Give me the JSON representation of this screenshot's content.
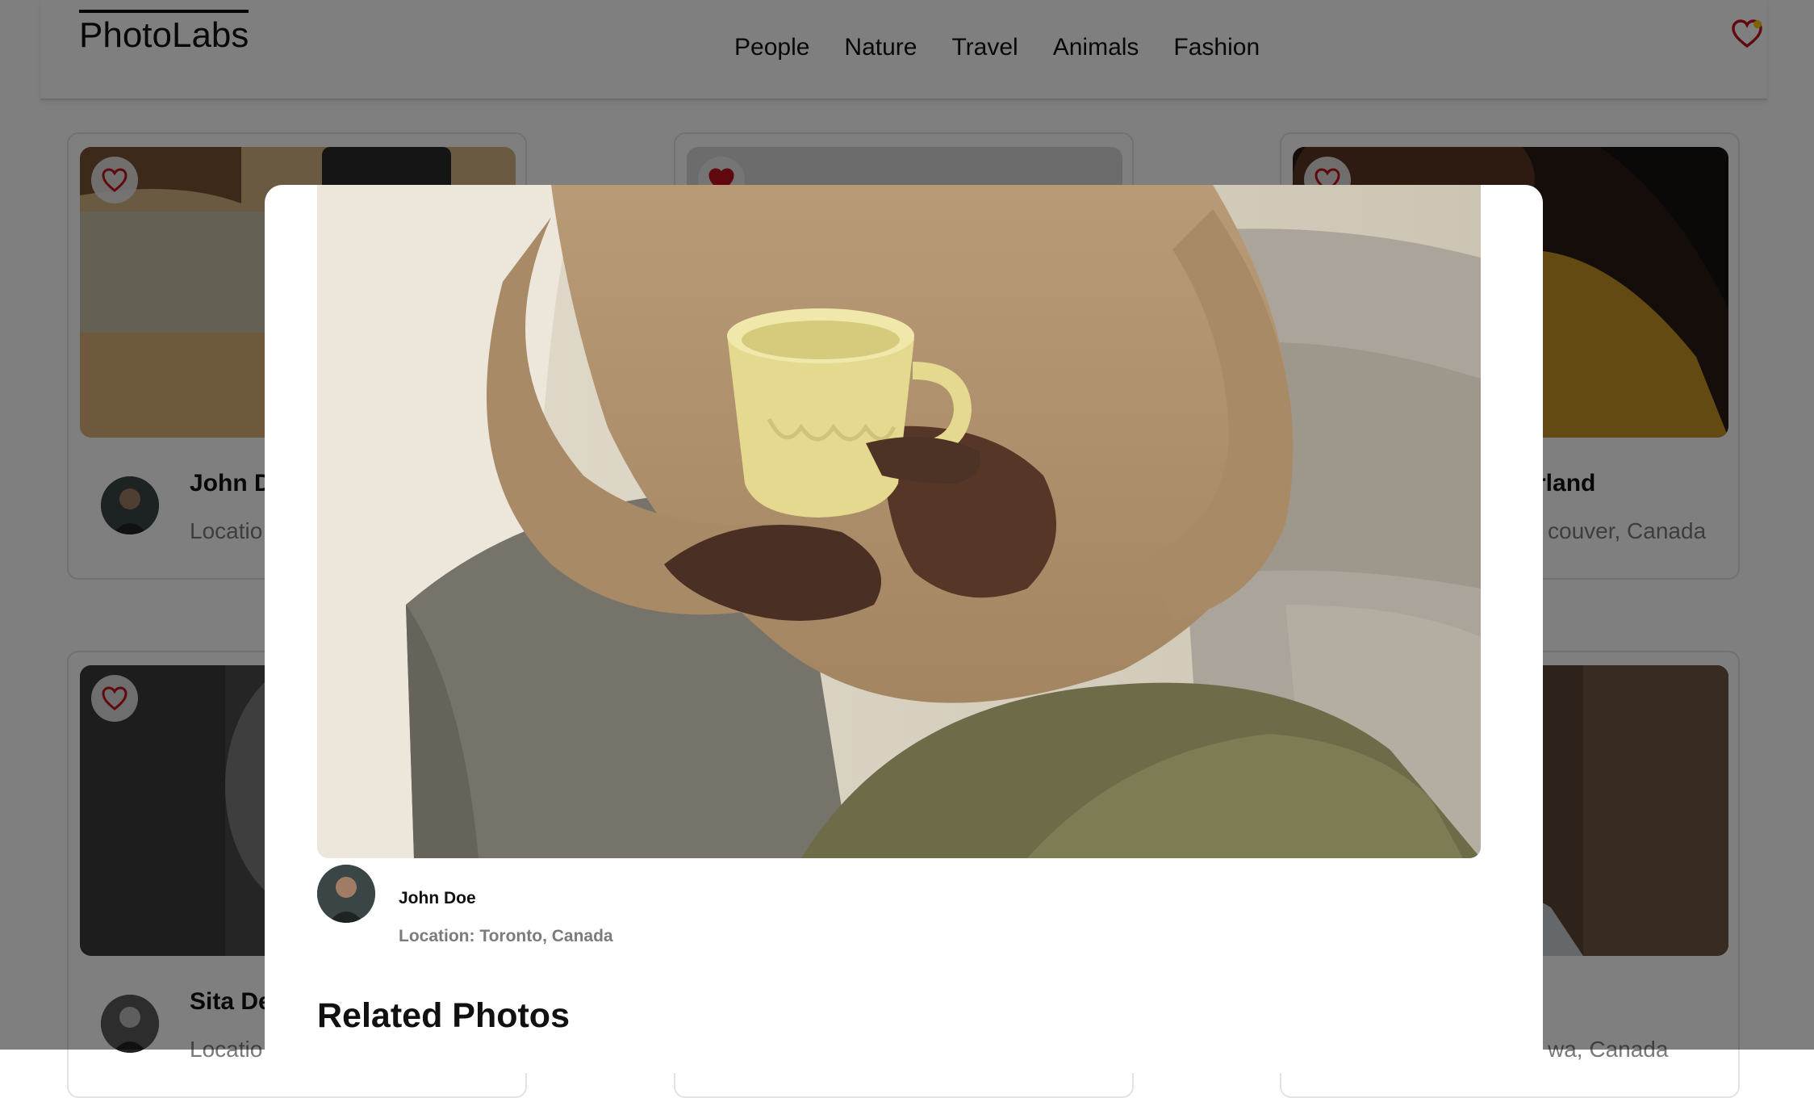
{
  "app": {
    "logo": "PhotoLabs"
  },
  "nav": {
    "topics": [
      "People",
      "Nature",
      "Travel",
      "Animals",
      "Fashion"
    ],
    "fav_indicator_color": "#f5c400"
  },
  "cards": [
    {
      "name": "John D",
      "location": "Locatio",
      "favourited": false
    },
    {
      "name": "",
      "location": "",
      "favourited": true
    },
    {
      "name": "rland",
      "location": "couver, Canada",
      "favourited": false
    },
    {
      "name": "Sita De",
      "location": "Locatio",
      "favourited": false
    },
    {
      "name": "",
      "location": "",
      "favourited": false
    },
    {
      "name": "",
      "location": "wa, Canada",
      "favourited": false
    }
  ],
  "modal": {
    "photographer_name": "John Doe",
    "location": "Location: Toronto, Canada",
    "related_title": "Related Photos"
  },
  "colors": {
    "heart_red": "#c0101a",
    "overlay": "rgba(0,0,0,0.5)"
  }
}
